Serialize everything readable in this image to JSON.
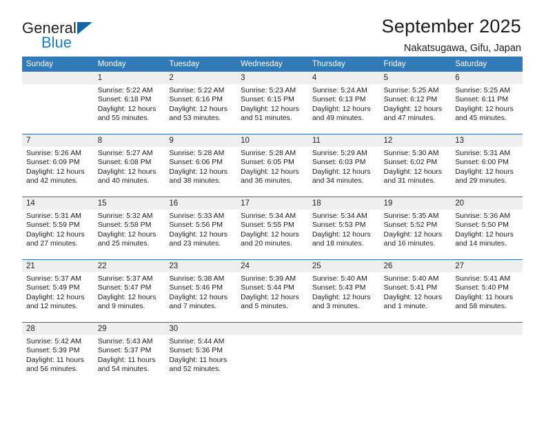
{
  "brand": {
    "name_part1": "General",
    "name_part2": "Blue",
    "triangle_color": "#1464a5",
    "blue_color": "#1a7dc4"
  },
  "header": {
    "title": "September 2025",
    "subtitle": "Nakatsugawa, Gifu, Japan"
  },
  "theme": {
    "header_row_bg": "#3279b7",
    "week_separator": "#2e6da8",
    "daynum_band_bg": "#efefef",
    "text": "#1a1a1a"
  },
  "weekdays": [
    "Sunday",
    "Monday",
    "Tuesday",
    "Wednesday",
    "Thursday",
    "Friday",
    "Saturday"
  ],
  "weeks": [
    [
      {
        "day": "",
        "sunrise": "",
        "sunset": "",
        "daylight1": "",
        "daylight2": "",
        "empty": true
      },
      {
        "day": "1",
        "sunrise": "Sunrise: 5:22 AM",
        "sunset": "Sunset: 6:18 PM",
        "daylight1": "Daylight: 12 hours",
        "daylight2": "and 55 minutes."
      },
      {
        "day": "2",
        "sunrise": "Sunrise: 5:22 AM",
        "sunset": "Sunset: 6:16 PM",
        "daylight1": "Daylight: 12 hours",
        "daylight2": "and 53 minutes."
      },
      {
        "day": "3",
        "sunrise": "Sunrise: 5:23 AM",
        "sunset": "Sunset: 6:15 PM",
        "daylight1": "Daylight: 12 hours",
        "daylight2": "and 51 minutes."
      },
      {
        "day": "4",
        "sunrise": "Sunrise: 5:24 AM",
        "sunset": "Sunset: 6:13 PM",
        "daylight1": "Daylight: 12 hours",
        "daylight2": "and 49 minutes."
      },
      {
        "day": "5",
        "sunrise": "Sunrise: 5:25 AM",
        "sunset": "Sunset: 6:12 PM",
        "daylight1": "Daylight: 12 hours",
        "daylight2": "and 47 minutes."
      },
      {
        "day": "6",
        "sunrise": "Sunrise: 5:25 AM",
        "sunset": "Sunset: 6:11 PM",
        "daylight1": "Daylight: 12 hours",
        "daylight2": "and 45 minutes."
      }
    ],
    [
      {
        "day": "7",
        "sunrise": "Sunrise: 5:26 AM",
        "sunset": "Sunset: 6:09 PM",
        "daylight1": "Daylight: 12 hours",
        "daylight2": "and 42 minutes."
      },
      {
        "day": "8",
        "sunrise": "Sunrise: 5:27 AM",
        "sunset": "Sunset: 6:08 PM",
        "daylight1": "Daylight: 12 hours",
        "daylight2": "and 40 minutes."
      },
      {
        "day": "9",
        "sunrise": "Sunrise: 5:28 AM",
        "sunset": "Sunset: 6:06 PM",
        "daylight1": "Daylight: 12 hours",
        "daylight2": "and 38 minutes."
      },
      {
        "day": "10",
        "sunrise": "Sunrise: 5:28 AM",
        "sunset": "Sunset: 6:05 PM",
        "daylight1": "Daylight: 12 hours",
        "daylight2": "and 36 minutes."
      },
      {
        "day": "11",
        "sunrise": "Sunrise: 5:29 AM",
        "sunset": "Sunset: 6:03 PM",
        "daylight1": "Daylight: 12 hours",
        "daylight2": "and 34 minutes."
      },
      {
        "day": "12",
        "sunrise": "Sunrise: 5:30 AM",
        "sunset": "Sunset: 6:02 PM",
        "daylight1": "Daylight: 12 hours",
        "daylight2": "and 31 minutes."
      },
      {
        "day": "13",
        "sunrise": "Sunrise: 5:31 AM",
        "sunset": "Sunset: 6:00 PM",
        "daylight1": "Daylight: 12 hours",
        "daylight2": "and 29 minutes."
      }
    ],
    [
      {
        "day": "14",
        "sunrise": "Sunrise: 5:31 AM",
        "sunset": "Sunset: 5:59 PM",
        "daylight1": "Daylight: 12 hours",
        "daylight2": "and 27 minutes."
      },
      {
        "day": "15",
        "sunrise": "Sunrise: 5:32 AM",
        "sunset": "Sunset: 5:58 PM",
        "daylight1": "Daylight: 12 hours",
        "daylight2": "and 25 minutes."
      },
      {
        "day": "16",
        "sunrise": "Sunrise: 5:33 AM",
        "sunset": "Sunset: 5:56 PM",
        "daylight1": "Daylight: 12 hours",
        "daylight2": "and 23 minutes."
      },
      {
        "day": "17",
        "sunrise": "Sunrise: 5:34 AM",
        "sunset": "Sunset: 5:55 PM",
        "daylight1": "Daylight: 12 hours",
        "daylight2": "and 20 minutes."
      },
      {
        "day": "18",
        "sunrise": "Sunrise: 5:34 AM",
        "sunset": "Sunset: 5:53 PM",
        "daylight1": "Daylight: 12 hours",
        "daylight2": "and 18 minutes."
      },
      {
        "day": "19",
        "sunrise": "Sunrise: 5:35 AM",
        "sunset": "Sunset: 5:52 PM",
        "daylight1": "Daylight: 12 hours",
        "daylight2": "and 16 minutes."
      },
      {
        "day": "20",
        "sunrise": "Sunrise: 5:36 AM",
        "sunset": "Sunset: 5:50 PM",
        "daylight1": "Daylight: 12 hours",
        "daylight2": "and 14 minutes."
      }
    ],
    [
      {
        "day": "21",
        "sunrise": "Sunrise: 5:37 AM",
        "sunset": "Sunset: 5:49 PM",
        "daylight1": "Daylight: 12 hours",
        "daylight2": "and 12 minutes."
      },
      {
        "day": "22",
        "sunrise": "Sunrise: 5:37 AM",
        "sunset": "Sunset: 5:47 PM",
        "daylight1": "Daylight: 12 hours",
        "daylight2": "and 9 minutes."
      },
      {
        "day": "23",
        "sunrise": "Sunrise: 5:38 AM",
        "sunset": "Sunset: 5:46 PM",
        "daylight1": "Daylight: 12 hours",
        "daylight2": "and 7 minutes."
      },
      {
        "day": "24",
        "sunrise": "Sunrise: 5:39 AM",
        "sunset": "Sunset: 5:44 PM",
        "daylight1": "Daylight: 12 hours",
        "daylight2": "and 5 minutes."
      },
      {
        "day": "25",
        "sunrise": "Sunrise: 5:40 AM",
        "sunset": "Sunset: 5:43 PM",
        "daylight1": "Daylight: 12 hours",
        "daylight2": "and 3 minutes."
      },
      {
        "day": "26",
        "sunrise": "Sunrise: 5:40 AM",
        "sunset": "Sunset: 5:41 PM",
        "daylight1": "Daylight: 12 hours",
        "daylight2": "and 1 minute."
      },
      {
        "day": "27",
        "sunrise": "Sunrise: 5:41 AM",
        "sunset": "Sunset: 5:40 PM",
        "daylight1": "Daylight: 11 hours",
        "daylight2": "and 58 minutes."
      }
    ],
    [
      {
        "day": "28",
        "sunrise": "Sunrise: 5:42 AM",
        "sunset": "Sunset: 5:39 PM",
        "daylight1": "Daylight: 11 hours",
        "daylight2": "and 56 minutes."
      },
      {
        "day": "29",
        "sunrise": "Sunrise: 5:43 AM",
        "sunset": "Sunset: 5:37 PM",
        "daylight1": "Daylight: 11 hours",
        "daylight2": "and 54 minutes."
      },
      {
        "day": "30",
        "sunrise": "Sunrise: 5:44 AM",
        "sunset": "Sunset: 5:36 PM",
        "daylight1": "Daylight: 11 hours",
        "daylight2": "and 52 minutes."
      },
      {
        "day": "",
        "sunrise": "",
        "sunset": "",
        "daylight1": "",
        "daylight2": "",
        "empty": true
      },
      {
        "day": "",
        "sunrise": "",
        "sunset": "",
        "daylight1": "",
        "daylight2": "",
        "empty": true
      },
      {
        "day": "",
        "sunrise": "",
        "sunset": "",
        "daylight1": "",
        "daylight2": "",
        "empty": true
      },
      {
        "day": "",
        "sunrise": "",
        "sunset": "",
        "daylight1": "",
        "daylight2": "",
        "empty": true
      }
    ]
  ]
}
